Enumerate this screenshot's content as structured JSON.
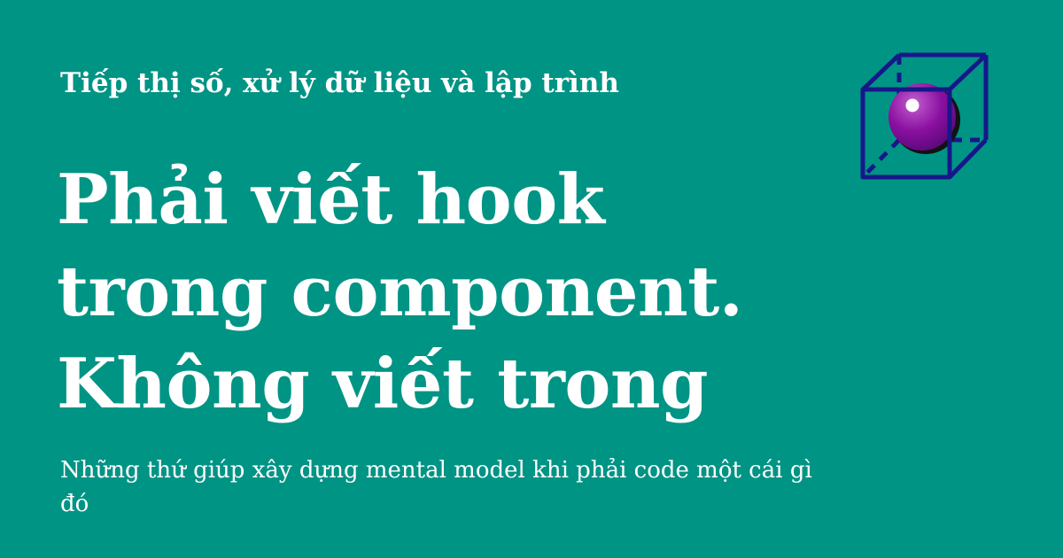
{
  "site": {
    "name": "Tiếp thị số, xử lý dữ liệu và lập trình"
  },
  "post": {
    "title_lines": [
      "Phải viết hook",
      "trong component.",
      "Không viết trong"
    ],
    "description": "Những thứ giúp xây dựng mental model khi phải code một cái gì đó"
  },
  "logo": {
    "icon": "cube-with-sphere-icon"
  },
  "colors": {
    "background": "#009485",
    "text": "#ffffff",
    "cube_stroke": "#16178a",
    "sphere": "#8a10a0",
    "sphere_shadow": "#121212"
  }
}
